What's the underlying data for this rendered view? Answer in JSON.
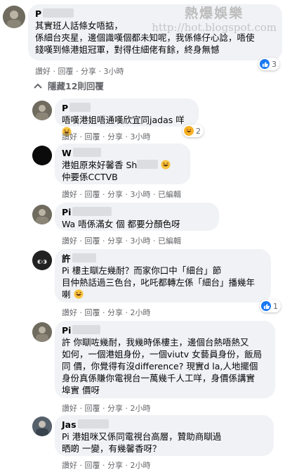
{
  "watermark": {
    "title": "熱爆娛樂",
    "url": "http://hot.blogspot.com"
  },
  "actions": {
    "like": "讚好",
    "reply": "回覆",
    "share": "分享",
    "edited": "已編輯",
    "sep": " · "
  },
  "hidden_replies": "隱藏12則回覆",
  "comments": [
    {
      "name": "P",
      "lines": [
        "其實班人話條女唔掂，",
        "係細台夾星，邊個識嘆個都未知呢，我係條仔心諗，唔使",
        "錢嘆到條港姐冠軍，對得住細佬有餘，終身無憾"
      ],
      "time": "3小時",
      "reactions": "3"
    },
    {
      "name": "P",
      "lines": [
        "唔嘆港姐唔通嘆欣宜同jadas 咩"
      ],
      "time": "3小時",
      "reactions": "2"
    },
    {
      "name": "W",
      "lines": [
        "港姐原來好馨香 Sh",
        "仲要係CCTVB"
      ],
      "time": "3小時",
      "edited": true
    },
    {
      "name": "Pi",
      "lines": [
        "Wa    唔係滿女   個   都要分顏色呀"
      ],
      "time": "3小時",
      "edited": true
    },
    {
      "name": "許",
      "subname": "Pi",
      "lines": [
        "Pi          樓主瞓左幾耐？而家你口中「細台」節",
        "目仲熱話過三色台，叱吒都轉左係「細台」播幾年",
        "喇"
      ],
      "time": "2小時",
      "reactions": "1"
    },
    {
      "name": "Pi",
      "lines": [
        "許   你瞓咗幾耐，我幾時係樓主，邊個台熱唔熱又",
        "如何，一個港姐身份，一個viutv 女藝員身份，飯局",
        "同   價，你覺得有沒difference? 現實d la,人地擺個",
        "身份真係賺你電視台一萬幾千人工咩，身價係講實",
        "埠實   價呀"
      ],
      "time": "2小時"
    },
    {
      "name": "Jas",
      "lines": [
        "Pi         港姐咪又係同電視台高層，贊助商瞓過",
        "晒啲       一變，有幾馨香呀？"
      ],
      "time": "2小時"
    }
  ]
}
